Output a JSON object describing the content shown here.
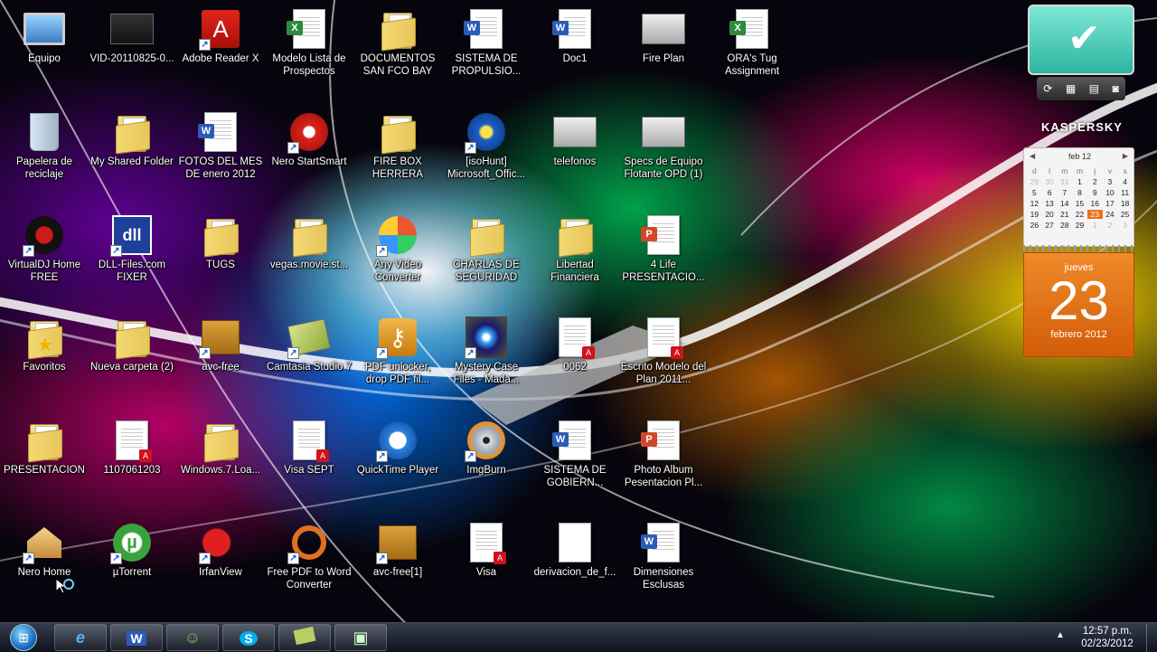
{
  "desktop": {
    "icons": [
      {
        "label": "Equipo",
        "icon": "computer-icon"
      },
      {
        "label": "VID-20110825-0...",
        "icon": "video-file-icon"
      },
      {
        "label": "Adobe Reader X",
        "icon": "adobe-reader-icon"
      },
      {
        "label": "Modelo Lista de Prospectos",
        "icon": "excel-doc-icon"
      },
      {
        "label": "DOCUMENTOS SAN FCO BAY",
        "icon": "folder-icon"
      },
      {
        "label": "SISTEMA DE PROPULSIO...",
        "icon": "word-doc-icon"
      },
      {
        "label": "Doc1",
        "icon": "word-doc-icon"
      },
      {
        "label": "Fire Plan",
        "icon": "image-file-icon"
      },
      {
        "label": "ORA's Tug Assignment",
        "icon": "excel-doc-icon"
      },
      {
        "label": "Papelera de reciclaje",
        "icon": "recycle-bin-icon"
      },
      {
        "label": "My Shared Folder",
        "icon": "shared-folder-icon"
      },
      {
        "label": "FOTOS DEL MES DE enero 2012",
        "icon": "word-doc-icon"
      },
      {
        "label": "Nero StartSmart",
        "icon": "nero-icon"
      },
      {
        "label": "FIRE BOX HERRERA",
        "icon": "folder-icon"
      },
      {
        "label": "[isoHunt] Microsoft_Offic...",
        "icon": "torrent-app-icon"
      },
      {
        "label": "telefonos",
        "icon": "image-file-icon"
      },
      {
        "label": "Specs de Equipo Flotante OPD (1)",
        "icon": "image-file-icon"
      },
      {
        "label": "VirtualDJ Home FREE",
        "icon": "virtualdj-icon"
      },
      {
        "label": "DLL-Files.com FIXER",
        "icon": "dll-fixer-icon"
      },
      {
        "label": "TUGS",
        "icon": "folder-icon"
      },
      {
        "label": "vegas.movie.st...",
        "icon": "folder-icon"
      },
      {
        "label": "Any Video Converter",
        "icon": "video-converter-icon"
      },
      {
        "label": "CHARLAS DE SEGURIDAD",
        "icon": "folder-icon"
      },
      {
        "label": "Libertad Financiera",
        "icon": "folder-icon"
      },
      {
        "label": "4 Life PRESENTACIO...",
        "icon": "powerpoint-doc-icon"
      },
      {
        "label": "Favoritos",
        "icon": "favorites-folder-icon"
      },
      {
        "label": "Nueva carpeta (2)",
        "icon": "folder-icon"
      },
      {
        "label": "avc-free",
        "icon": "installer-icon"
      },
      {
        "label": "Camtasia Studio 7",
        "icon": "camtasia-icon"
      },
      {
        "label": "PDF unlocker, drop PDF fil...",
        "icon": "key-icon"
      },
      {
        "label": "Mystery Case Files - Mada...",
        "icon": "game-icon"
      },
      {
        "label": "0062",
        "icon": "pdf-doc-icon"
      },
      {
        "label": "Escrito Modelo del Plan 2011...",
        "icon": "pdf-doc-icon"
      },
      {
        "label": "PRESENTACION",
        "icon": "folder-icon"
      },
      {
        "label": "1107061203",
        "icon": "pdf-doc-icon"
      },
      {
        "label": "Windows.7.Loa...",
        "icon": "folder-icon"
      },
      {
        "label": "Visa SEPT",
        "icon": "pdf-doc-icon"
      },
      {
        "label": "QuickTime Player",
        "icon": "quicktime-icon"
      },
      {
        "label": "ImgBurn",
        "icon": "imgburn-icon"
      },
      {
        "label": "SISTEMA DE GOBIERN...",
        "icon": "word-doc-icon"
      },
      {
        "label": "Photo Album Pesentacion Pl...",
        "icon": "powerpoint-doc-icon"
      },
      {
        "label": "Nero Home",
        "icon": "nero-home-icon"
      },
      {
        "label": "µTorrent",
        "icon": "utorrent-icon"
      },
      {
        "label": "IrfanView",
        "icon": "irfanview-icon"
      },
      {
        "label": "Free PDF to Word Converter",
        "icon": "pdf-converter-icon"
      },
      {
        "label": "avc-free[1]",
        "icon": "installer-icon"
      },
      {
        "label": "Visa",
        "icon": "pdf-doc-icon"
      },
      {
        "label": "derivacion_de_f...",
        "icon": "blank-file-icon"
      },
      {
        "label": "Dimensiones Esclusas",
        "icon": "word-doc-icon"
      }
    ]
  },
  "kaspersky": {
    "brand": "KASPERSKY"
  },
  "calendar": {
    "month_label": "feb 12",
    "day_headers": [
      "d",
      "l",
      "m",
      "m",
      "j",
      "v",
      "s"
    ],
    "weeks": [
      [
        "29",
        "30",
        "31",
        "1",
        "2",
        "3",
        "4"
      ],
      [
        "5",
        "6",
        "7",
        "8",
        "9",
        "10",
        "11"
      ],
      [
        "12",
        "13",
        "14",
        "15",
        "16",
        "17",
        "18"
      ],
      [
        "19",
        "20",
        "21",
        "22",
        "23",
        "24",
        "25"
      ],
      [
        "26",
        "27",
        "28",
        "29",
        "1",
        "2",
        "3"
      ]
    ],
    "weekday": "jueves",
    "day": "23",
    "month_year": "febrero 2012"
  },
  "taskbar": {
    "apps": [
      "internet-explorer-icon",
      "word-icon",
      "messenger-icon",
      "skype-icon",
      "camtasia-icon",
      "video-camera-icon"
    ],
    "time": "12:57 p.m.",
    "date": "02/23/2012"
  }
}
